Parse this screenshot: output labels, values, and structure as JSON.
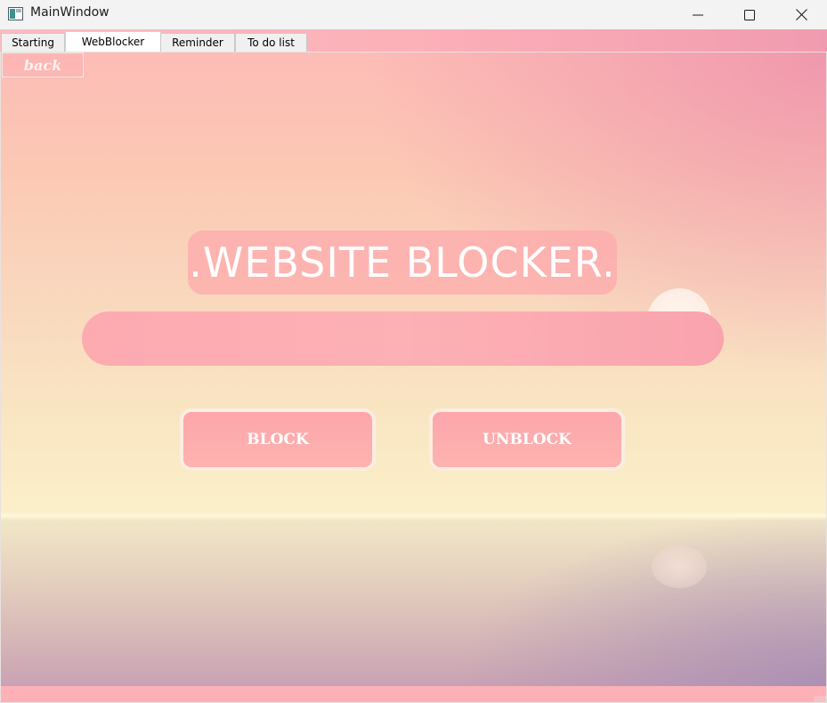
{
  "window": {
    "title": "MainWindow",
    "icons": {
      "app": "app-window-icon",
      "minimize": "minimize-icon",
      "maximize": "maximize-icon",
      "close": "close-icon"
    }
  },
  "tabs": [
    {
      "label": "Starting",
      "active": false
    },
    {
      "label": "WebBlocker",
      "active": true
    },
    {
      "label": "Reminder",
      "active": false
    },
    {
      "label": "To do list",
      "active": false
    }
  ],
  "webblocker": {
    "back_label": "back",
    "heading": ".WEBSITE BLOCKER.",
    "url_input": {
      "value": "",
      "placeholder": ""
    },
    "block_label": "BLOCK",
    "unblock_label": "UNBLOCK"
  },
  "colors": {
    "accent_pink": "#fdaab1",
    "text_white": "#ffffff",
    "button_border": "#fbede0"
  }
}
